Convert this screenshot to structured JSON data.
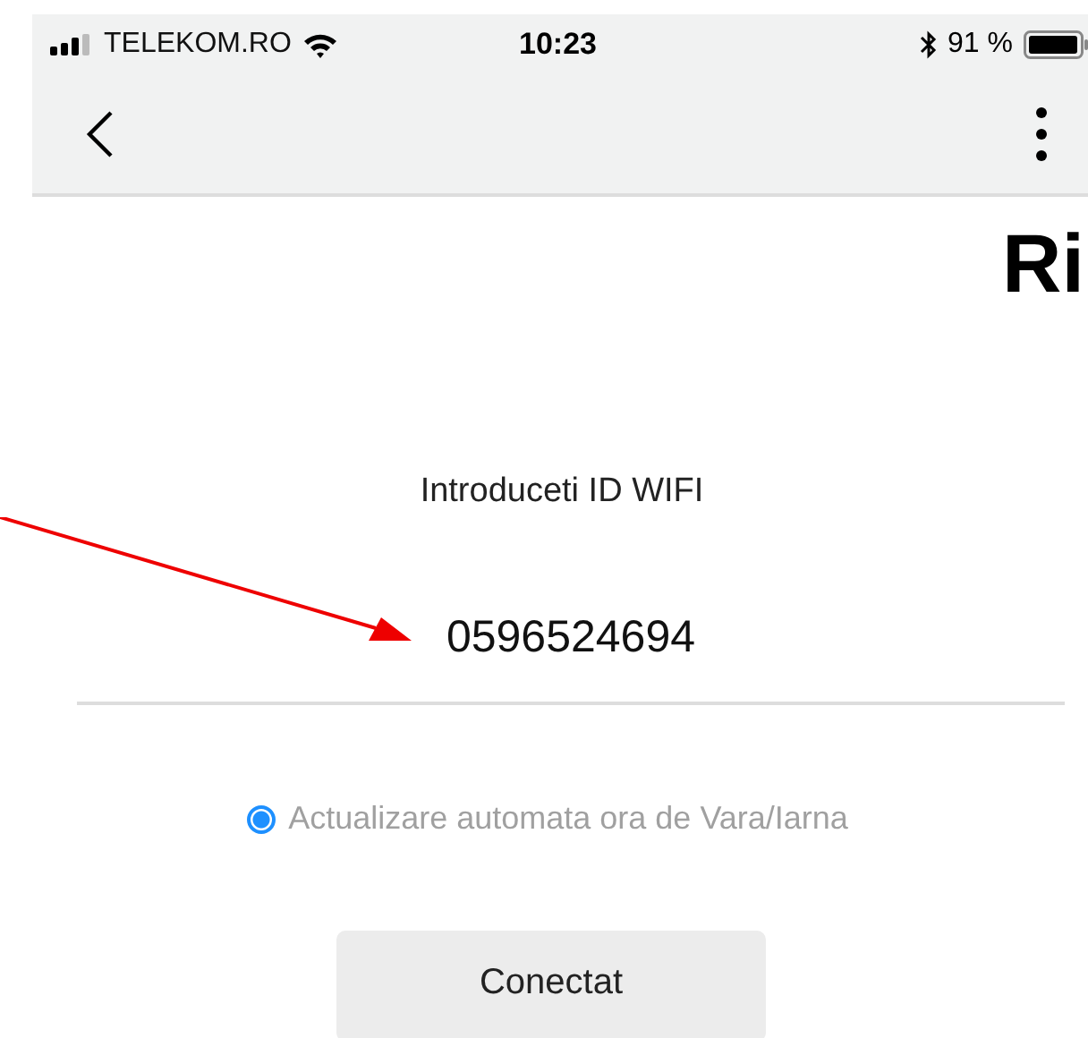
{
  "status_bar": {
    "carrier": "TELEKOM.RO",
    "time": "10:23",
    "battery": "91 %"
  },
  "logo": {
    "text": "Ri"
  },
  "form": {
    "label": "Introduceti ID WIFI",
    "wifi_id": "0596524694",
    "option": {
      "label": "Actualizare automata ora de Vara/Iarna",
      "selected": true
    },
    "button": "Conectat"
  }
}
